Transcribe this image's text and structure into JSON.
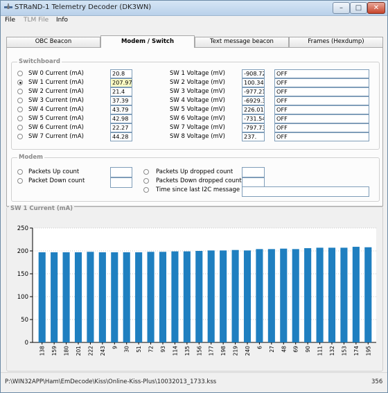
{
  "window": {
    "title": "STRaND-1 Telemetry Decoder (DK3WN)"
  },
  "menu": {
    "file": "File",
    "tlm_file": "TLM File",
    "info": "Info"
  },
  "tabs": [
    "OBC Beacon",
    "Modem / Switch",
    "Text message beacon",
    "Frames (Hexdump)"
  ],
  "active_tab": 1,
  "switchboard": {
    "title": "Switchboard",
    "selected_current": 1,
    "currents": [
      {
        "label": "SW 0 Current (mA)",
        "value": "20.8"
      },
      {
        "label": "SW 1 Current (mA)",
        "value": "207.97"
      },
      {
        "label": "SW 2 Current (mA)",
        "value": "21.4"
      },
      {
        "label": "SW 3 Current (mA)",
        "value": "37.39"
      },
      {
        "label": "SW 4  Current (mA)",
        "value": "43.79"
      },
      {
        "label": "SW 5  Current (mA)",
        "value": "42.98"
      },
      {
        "label": "SW 6 Current (mA)",
        "value": "22.27"
      },
      {
        "label": "SW 7 Current (mA)",
        "value": "44.28"
      }
    ],
    "voltages": [
      {
        "label": "SW 1 Voltage (mV)",
        "value": "-908.72",
        "state": "OFF"
      },
      {
        "label": "SW 2 Voltage (mV)",
        "value": "100.34",
        "state": "OFF"
      },
      {
        "label": "SW 3 Voltage (mV)",
        "value": "-977.21",
        "state": "OFF"
      },
      {
        "label": "SW 4 Voltage (mV)",
        "value": "-6929.3",
        "state": "OFF"
      },
      {
        "label": "SW 5 Voltage (mV)",
        "value": "226.01",
        "state": "OFF"
      },
      {
        "label": "SW 6 Voltage (mV)",
        "value": "-731.54",
        "state": "OFF"
      },
      {
        "label": "SW 7 Voltage (mV)",
        "value": "-797.73",
        "state": "OFF"
      },
      {
        "label": "SW 8 Voltage (mV)",
        "value": "237.",
        "state": "OFF"
      }
    ]
  },
  "modem": {
    "title": "Modem",
    "packets_up": {
      "label": "Packets Up count",
      "value": ""
    },
    "packet_down": {
      "label": "Packet Down count",
      "value": ""
    },
    "packets_up_dropped": {
      "label": "Packets Up dropped count",
      "value": ""
    },
    "packets_down_dropped": {
      "label": "Packets Down dropped count",
      "value": ""
    },
    "time_since_i2c": {
      "label": "Time since last I2C message",
      "value": ""
    }
  },
  "chart_data": {
    "type": "bar",
    "title": "SW 1 Current (mA)",
    "xlabel": "",
    "ylabel": "",
    "ylim": [
      0,
      250
    ],
    "yticks": [
      0,
      50,
      100,
      150,
      200,
      250
    ],
    "grid": true,
    "bar_color": "#1f7fc0",
    "categories": [
      "138",
      "159",
      "180",
      "201",
      "222",
      "243",
      "9",
      "30",
      "51",
      "72",
      "93",
      "114",
      "135",
      "156",
      "177",
      "198",
      "219",
      "240",
      "6",
      "27",
      "48",
      "69",
      "90",
      "111",
      "132",
      "153",
      "174",
      "195"
    ],
    "values": [
      197,
      197,
      197,
      197,
      198,
      197,
      197,
      197,
      197,
      198,
      198,
      199,
      199,
      200,
      201,
      201,
      202,
      201,
      204,
      204,
      205,
      204,
      206,
      207,
      207,
      207,
      209,
      208
    ]
  },
  "status": {
    "path": "P:\\WIN32APP\\Ham\\EmDecode\\Kiss\\Online-Kiss-Plus\\10032013_1733.kss",
    "count": "356"
  }
}
